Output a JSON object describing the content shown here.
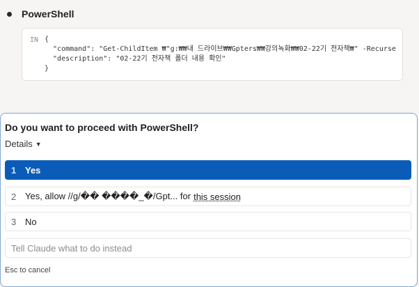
{
  "tool": {
    "title": "PowerShell"
  },
  "code": {
    "in_label": "IN",
    "lines": [
      "{",
      "  \"command\": \"Get-ChildItem ₩\"g:₩₩내 드라이브₩₩Gpters₩₩강의녹화₩₩02-22기 전자책₩\" -Recurse",
      "  \"description\": \"02-22기 전자책 폴더 내용 확인\"",
      "}"
    ]
  },
  "dialog": {
    "question_prefix": "Do you want to proceed with ",
    "question_tool": "PowerShell",
    "question_suffix": "?",
    "details_label": "Details",
    "options": [
      {
        "num": "1",
        "label": "Yes"
      },
      {
        "num": "2",
        "label": "Yes, allow //g/�� ����_�/Gpt... for",
        "session": "this session"
      },
      {
        "num": "3",
        "label": "No"
      }
    ],
    "instead_placeholder": "Tell Claude what to do instead",
    "esc_hint": "Esc to cancel"
  }
}
